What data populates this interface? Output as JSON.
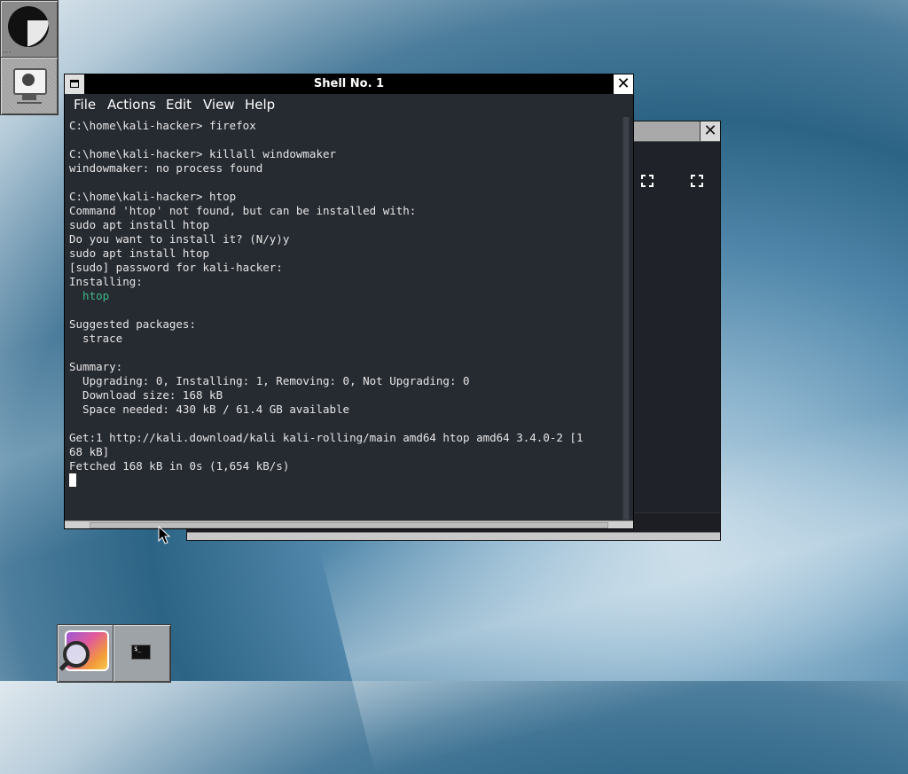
{
  "desktop": {
    "dock_top": [
      {
        "name": "windowmaker-logo"
      },
      {
        "name": "monitor-icon"
      }
    ],
    "dock_bottom": [
      {
        "name": "image-viewer-icon"
      },
      {
        "name": "terminal-icon",
        "glyph": "$_"
      }
    ]
  },
  "shell_window": {
    "title": "Shell No. 1",
    "close_glyph": "✕",
    "menu": [
      "File",
      "Actions",
      "Edit",
      "View",
      "Help"
    ],
    "lines": [
      "C:\\home\\kali-hacker> firefox",
      "",
      "C:\\home\\kali-hacker> killall windowmaker",
      "windowmaker: no process found",
      "",
      "C:\\home\\kali-hacker> htop",
      "Command 'htop' not found, but can be installed with:",
      "sudo apt install htop",
      "Do you want to install it? (N/y)y",
      "sudo apt install htop",
      "[sudo] password for kali-hacker:",
      "Installing:",
      "  htop",
      "",
      "Suggested packages:",
      "  strace",
      "",
      "Summary:",
      "  Upgrading: 0, Installing: 1, Removing: 0, Not Upgrading: 0",
      "  Download size: 168 kB",
      "  Space needed: 430 kB / 61.4 GB available",
      "",
      "Get:1 http://kali.download/kali kali-rolling/main amd64 htop amd64 3.4.0-2 [1",
      "68 kB]",
      "Fetched 168 kB in 0s (1,654 kB/s)"
    ],
    "highlight_line": 12,
    "highlight_color": "#3fb98a"
  },
  "back_window": {
    "close_glyph": "✕"
  }
}
